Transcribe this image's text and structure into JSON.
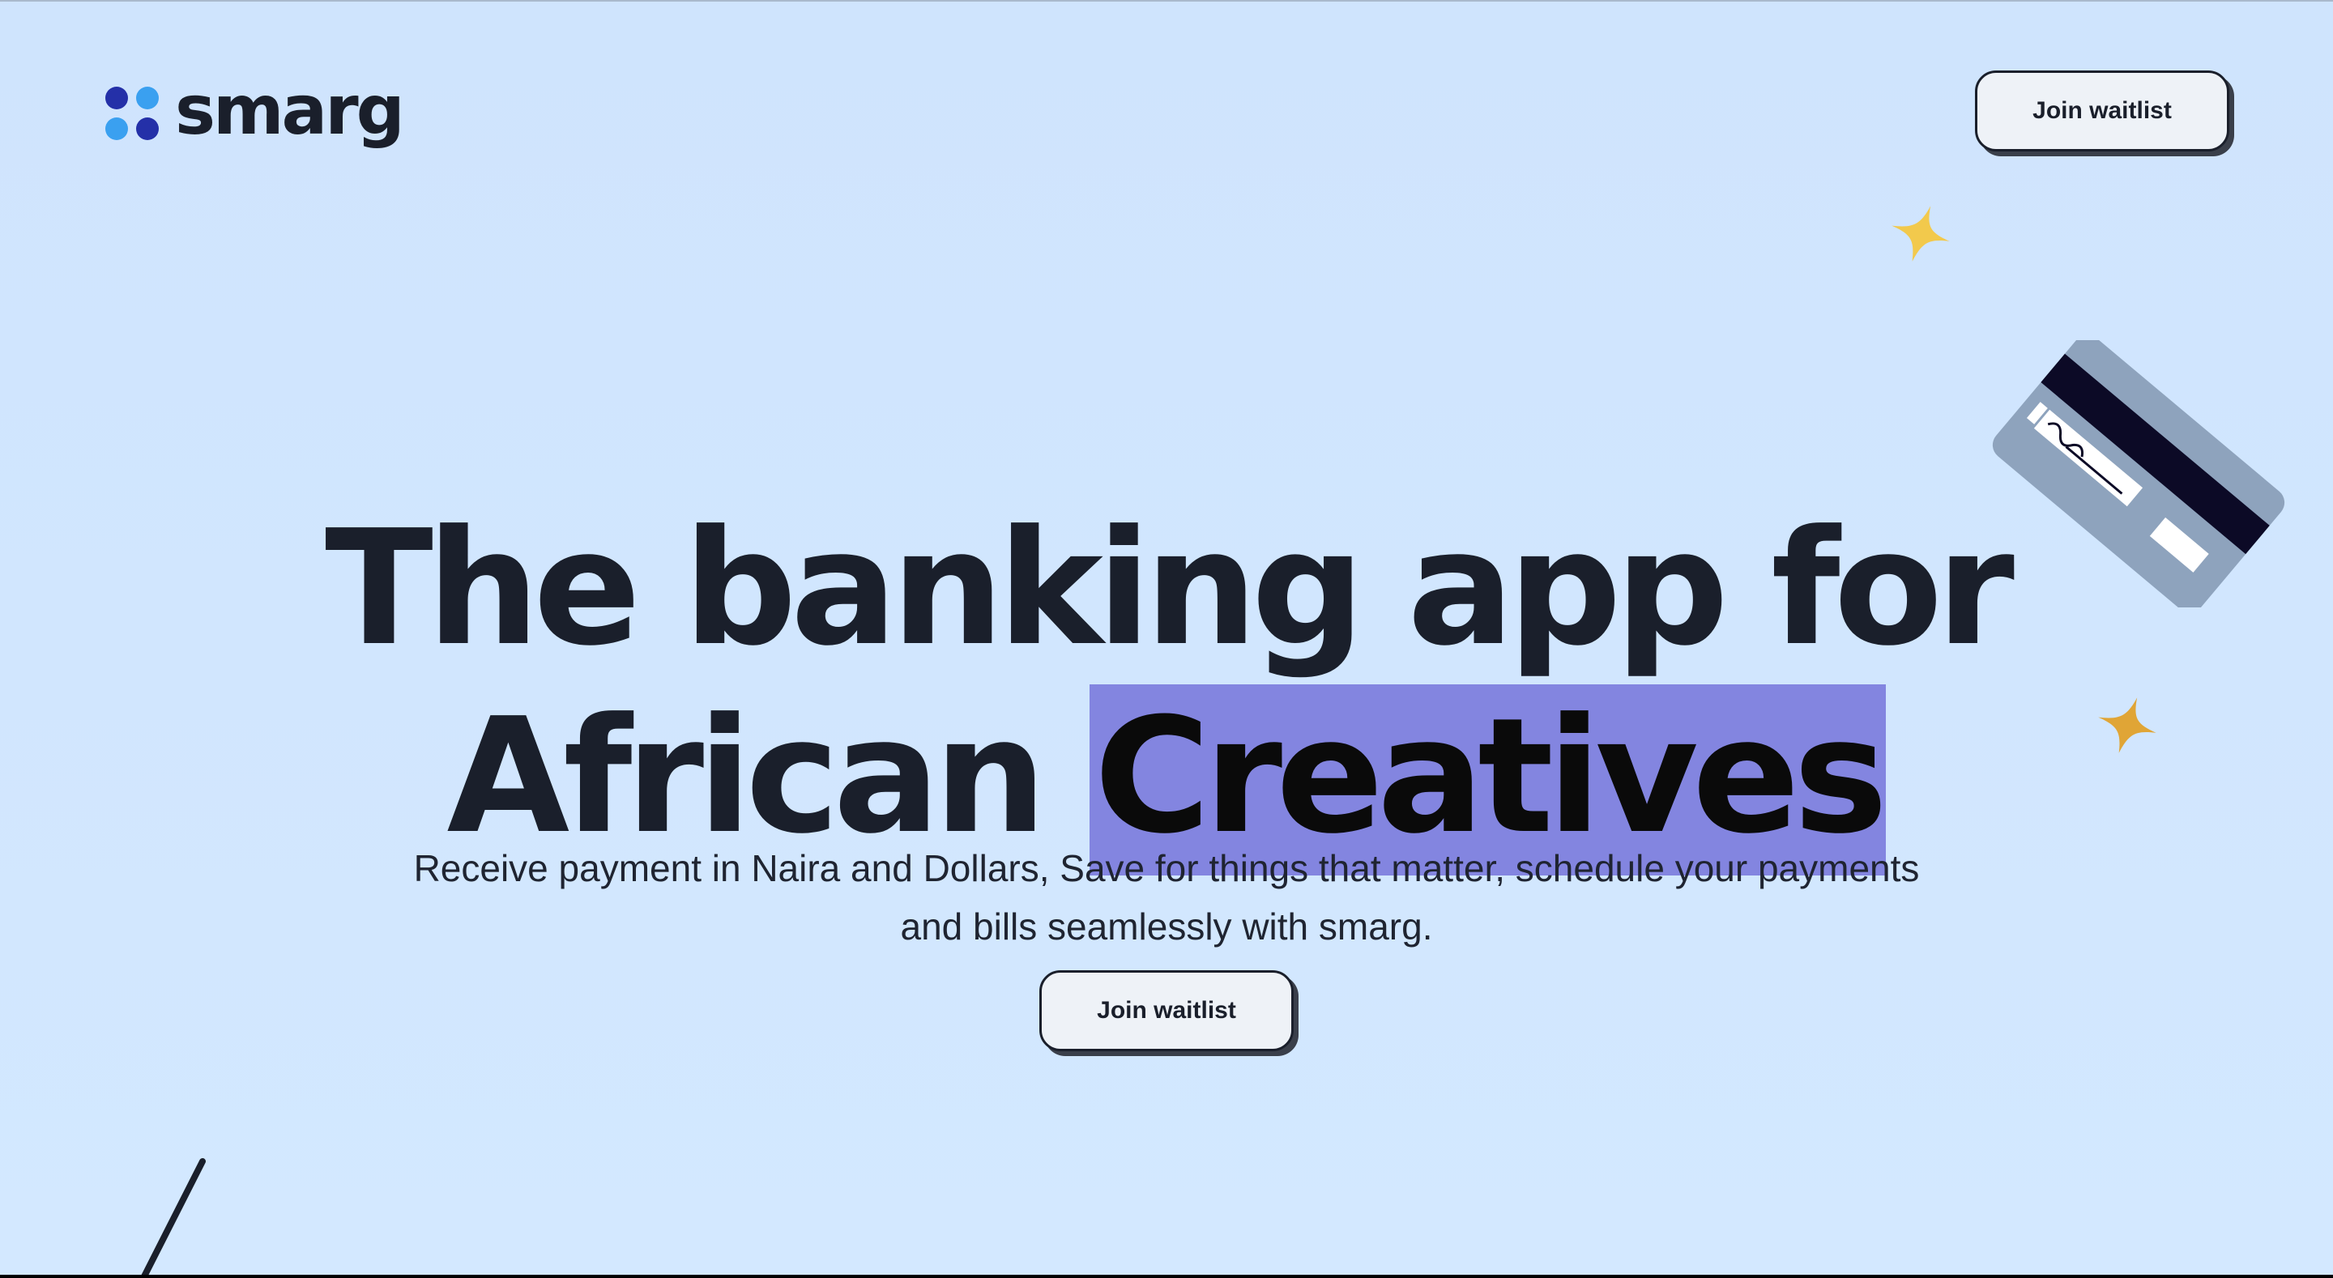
{
  "header": {
    "logo_text": "smarg",
    "logo_dot_colors": [
      "#2430a8",
      "#3aa0f0",
      "#3aa0f0",
      "#2430a8"
    ],
    "cta_label": "Join waitlist"
  },
  "hero": {
    "headline_line1": "The banking app for",
    "headline_line2_plain": "African",
    "headline_line2_highlight": "Creatives",
    "highlight_color": "#8385e0",
    "subtitle_line1": "Receive payment in Naira and Dollars, Save for things that matter, schedule your payments",
    "subtitle_line2": "and bills seamlessly with smarg.",
    "cta_label": "Join waitlist"
  },
  "decorations": {
    "star_colors": [
      "#f2c94c",
      "#e0a536"
    ],
    "card_icon": "credit-card-illustration",
    "pen_icon": "pen-illustration"
  },
  "colors": {
    "background": "#cfe4fd",
    "text": "#1a1f2b",
    "button_bg": "#eef2f7"
  }
}
